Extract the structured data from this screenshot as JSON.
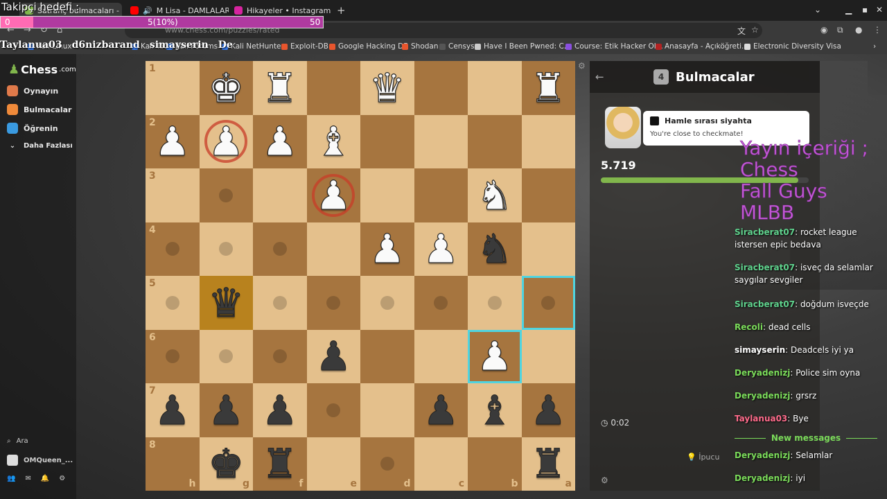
{
  "browser": {
    "tabs": [
      {
        "label": "Satranç bulmacaları -",
        "favicon_color": "#81b64c",
        "active": true
      },
      {
        "label": "M Lisa - DAMLALAR -",
        "favicon_color": "#ff0000",
        "active": false
      },
      {
        "label": "Hikayeler • Instagram",
        "favicon_color": "#d6249f",
        "active": false
      }
    ],
    "url": "www.chess.com/puzzles/rated",
    "bookmarks": [
      {
        "label": "Kali Linux",
        "color": "#367bf0"
      },
      {
        "label": "Kali Tools",
        "color": "#367bf0"
      },
      {
        "label": "Kali Forums",
        "color": "#367bf0"
      },
      {
        "label": "Kali NetHunter",
        "color": "#367bf0"
      },
      {
        "label": "Exploit-DB",
        "color": "#e8552d"
      },
      {
        "label": "Google Hacking DB",
        "color": "#e8552d"
      },
      {
        "label": "Shodan",
        "color": "#e8552d"
      },
      {
        "label": "Censys",
        "color": "#555555"
      },
      {
        "label": "Have I Been Pwned: C...",
        "color": "#cccccc"
      },
      {
        "label": "Course: Etik Hacker Ol...",
        "color": "#8a4fe0"
      },
      {
        "label": "Anasayfa - Açıköğreti...",
        "color": "#b22222"
      },
      {
        "label": "Electronic Diversity Visa",
        "color": "#dddddd"
      }
    ]
  },
  "overlay": {
    "goal_title": "Takipçi hedefi :",
    "goal_start": "0",
    "goal_progress": "5(10%)",
    "goal_end": "50",
    "goal_fraction": 0.1,
    "names": [
      "Taylanua03",
      "d6nizbarand",
      "simayserin",
      "De"
    ],
    "stream_content": "Yayın içeriği ;\nChess\nFall Guys\nMLBB"
  },
  "sidebar": {
    "logo": "Chess",
    "logo_suffix": ".com",
    "items": [
      {
        "label": "Oynayın",
        "icon": "pawn-icon",
        "color": "#e07a4a"
      },
      {
        "label": "Bulmacalar",
        "icon": "puzzle-icon",
        "color": "#f08a3a"
      },
      {
        "label": "Öğrenin",
        "icon": "graduation-icon",
        "color": "#3a9ae0"
      },
      {
        "label": "Daha Fazlası",
        "icon": "chevron-down-icon",
        "color": "#888888"
      }
    ],
    "search": "Ara",
    "username": "OMQueen_..."
  },
  "board": {
    "rank_labels": [
      "1",
      "2",
      "3",
      "4",
      "5",
      "6",
      "7",
      "8"
    ],
    "file_labels": [
      "h",
      "g",
      "f",
      "e",
      "d",
      "c",
      "b",
      "a"
    ],
    "rows": [
      [
        "",
        "wK",
        "wR",
        "",
        "wQ",
        "",
        "",
        "wR"
      ],
      [
        "wP",
        "wP",
        "wP",
        "wB",
        "",
        "",
        "",
        ""
      ],
      [
        "",
        "",
        "",
        "wP",
        "",
        "",
        "wN",
        ""
      ],
      [
        "",
        "",
        "",
        "",
        "wP",
        "wP",
        "bN",
        ""
      ],
      [
        "",
        "bQ",
        "",
        "",
        "",
        "",
        "",
        ""
      ],
      [
        "",
        "",
        "",
        "bP",
        "",
        "",
        "wP",
        ""
      ],
      [
        "bP",
        "bP",
        "bP",
        "",
        "",
        "bP",
        "bB",
        "bP"
      ],
      [
        "",
        "bK",
        "bR",
        "",
        "",
        "",
        "",
        "bR"
      ]
    ],
    "dots": [
      [
        2,
        1
      ],
      [
        3,
        0
      ],
      [
        3,
        1
      ],
      [
        3,
        2
      ],
      [
        4,
        0
      ],
      [
        4,
        2
      ],
      [
        4,
        3
      ],
      [
        4,
        4
      ],
      [
        4,
        5
      ],
      [
        4,
        6
      ],
      [
        4,
        7
      ],
      [
        5,
        0
      ],
      [
        5,
        1
      ],
      [
        5,
        2
      ],
      [
        6,
        3
      ],
      [
        7,
        4
      ]
    ],
    "rings": [
      [
        1,
        1
      ],
      [
        2,
        3
      ]
    ],
    "highlight": [
      4,
      1
    ],
    "selected": [
      [
        4,
        7
      ],
      [
        5,
        6
      ]
    ]
  },
  "panel": {
    "title": "Bulmacalar",
    "puzzle_badge": "4",
    "bubble_title": "Hamle sırası siyahta",
    "bubble_sub": "You're close to checkmate!",
    "rating": "5.719",
    "rating_progress": 0.95,
    "timer": "0:02",
    "hint": "İpucu"
  },
  "chat": [
    {
      "user": "Siracberat07",
      "color": "#5fd38d",
      "text": "rocket league istersen epic bedava"
    },
    {
      "user": "Siracberat07",
      "color": "#5fd38d",
      "text": "isveç da selamlar saygılar sevgiler"
    },
    {
      "user": "Siracberat07",
      "color": "#5fd38d",
      "text": "doğdum isveçde"
    },
    {
      "user": "Recoli",
      "color": "#7bdc5a",
      "text": "dead cells"
    },
    {
      "user": "simayserin",
      "color": "#ffffff",
      "text": "Deadcels iyi ya"
    },
    {
      "user": "Deryadenizj",
      "color": "#7bdc5a",
      "text": "Police sim oyna"
    },
    {
      "user": "Deryadenizj",
      "color": "#7bdc5a",
      "text": "grsrz"
    },
    {
      "user": "Taylanua03",
      "color": "#ff6b8b",
      "text": "Bye"
    },
    {
      "user": "Deryadenizj",
      "color": "#7bdc5a",
      "text": "Selamlar"
    },
    {
      "user": "Deryadenizj",
      "color": "#7bdc5a",
      "text": "iyi"
    }
  ],
  "chat_new_messages": "New messages"
}
